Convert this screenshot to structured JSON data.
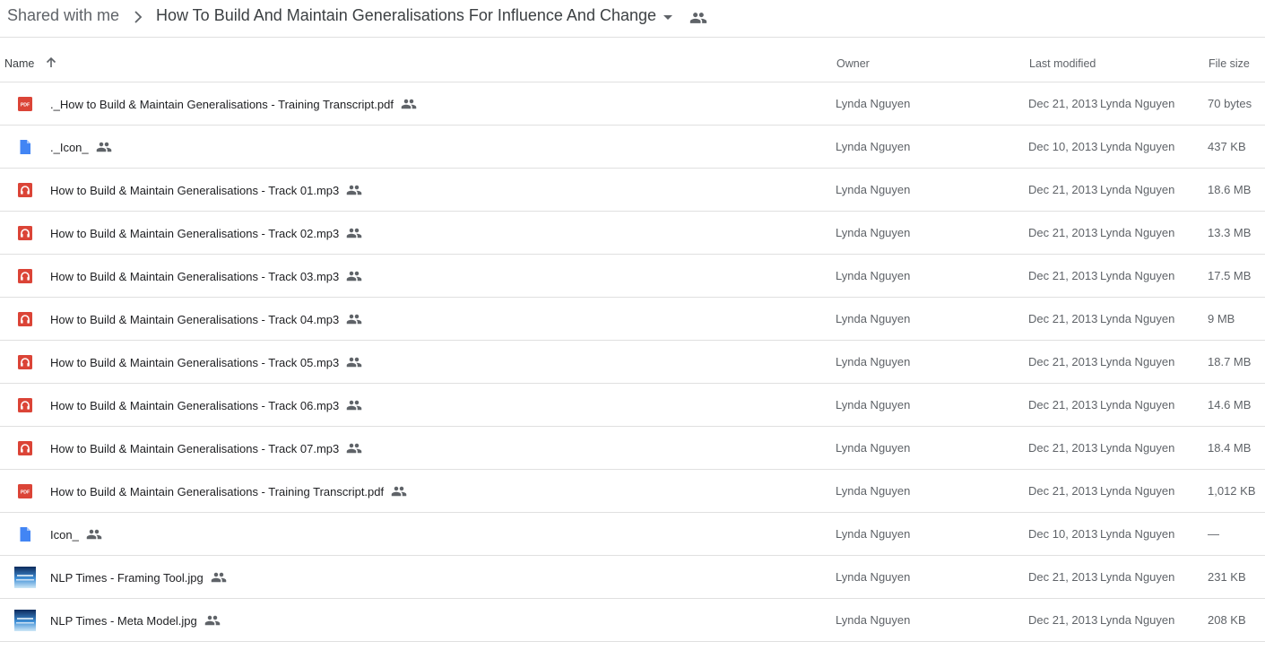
{
  "breadcrumb": {
    "root": "Shared with me",
    "current": "How To Build And Maintain Generalisations For Influence And Change"
  },
  "columns": {
    "name": "Name",
    "owner": "Owner",
    "last_modified": "Last modified",
    "file_size": "File size"
  },
  "colors": {
    "pdf_red": "#db4437",
    "audio_red": "#db4437",
    "doc_blue": "#4285f4",
    "text_secondary": "#5f6368",
    "divider": "#e0e0e0"
  },
  "files": [
    {
      "name": "._How to Build & Maintain Generalisations - Training Transcript.pdf",
      "icon": "pdf-icon",
      "owner": "Lynda Nguyen",
      "modified_date": "Dec 21, 2013",
      "modified_by": "Lynda Nguyen",
      "size": "70 bytes"
    },
    {
      "name": "._Icon_",
      "icon": "file-icon",
      "owner": "Lynda Nguyen",
      "modified_date": "Dec 10, 2013",
      "modified_by": "Lynda Nguyen",
      "size": "437 KB"
    },
    {
      "name": "How to Build & Maintain Generalisations - Track 01.mp3",
      "icon": "audio-icon",
      "owner": "Lynda Nguyen",
      "modified_date": "Dec 21, 2013",
      "modified_by": "Lynda Nguyen",
      "size": "18.6 MB"
    },
    {
      "name": "How to Build & Maintain Generalisations - Track 02.mp3",
      "icon": "audio-icon",
      "owner": "Lynda Nguyen",
      "modified_date": "Dec 21, 2013",
      "modified_by": "Lynda Nguyen",
      "size": "13.3 MB"
    },
    {
      "name": "How to Build & Maintain Generalisations - Track 03.mp3",
      "icon": "audio-icon",
      "owner": "Lynda Nguyen",
      "modified_date": "Dec 21, 2013",
      "modified_by": "Lynda Nguyen",
      "size": "17.5 MB"
    },
    {
      "name": "How to Build & Maintain Generalisations - Track 04.mp3",
      "icon": "audio-icon",
      "owner": "Lynda Nguyen",
      "modified_date": "Dec 21, 2013",
      "modified_by": "Lynda Nguyen",
      "size": "9 MB"
    },
    {
      "name": "How to Build & Maintain Generalisations - Track 05.mp3",
      "icon": "audio-icon",
      "owner": "Lynda Nguyen",
      "modified_date": "Dec 21, 2013",
      "modified_by": "Lynda Nguyen",
      "size": "18.7 MB"
    },
    {
      "name": "How to Build & Maintain Generalisations - Track 06.mp3",
      "icon": "audio-icon",
      "owner": "Lynda Nguyen",
      "modified_date": "Dec 21, 2013",
      "modified_by": "Lynda Nguyen",
      "size": "14.6 MB"
    },
    {
      "name": "How to Build & Maintain Generalisations - Track 07.mp3",
      "icon": "audio-icon",
      "owner": "Lynda Nguyen",
      "modified_date": "Dec 21, 2013",
      "modified_by": "Lynda Nguyen",
      "size": "18.4 MB"
    },
    {
      "name": "How to Build & Maintain Generalisations - Training Transcript.pdf",
      "icon": "pdf-icon",
      "owner": "Lynda Nguyen",
      "modified_date": "Dec 21, 2013",
      "modified_by": "Lynda Nguyen",
      "size": "1,012 KB"
    },
    {
      "name": "Icon_",
      "icon": "file-icon",
      "owner": "Lynda Nguyen",
      "modified_date": "Dec 10, 2013",
      "modified_by": "Lynda Nguyen",
      "size": "—"
    },
    {
      "name": "NLP Times - Framing Tool.jpg",
      "icon": "image-thumbnail-icon",
      "owner": "Lynda Nguyen",
      "modified_date": "Dec 21, 2013",
      "modified_by": "Lynda Nguyen",
      "size": "231 KB"
    },
    {
      "name": "NLP Times - Meta Model.jpg",
      "icon": "image-thumbnail-icon",
      "owner": "Lynda Nguyen",
      "modified_date": "Dec 21, 2013",
      "modified_by": "Lynda Nguyen",
      "size": "208 KB"
    }
  ]
}
